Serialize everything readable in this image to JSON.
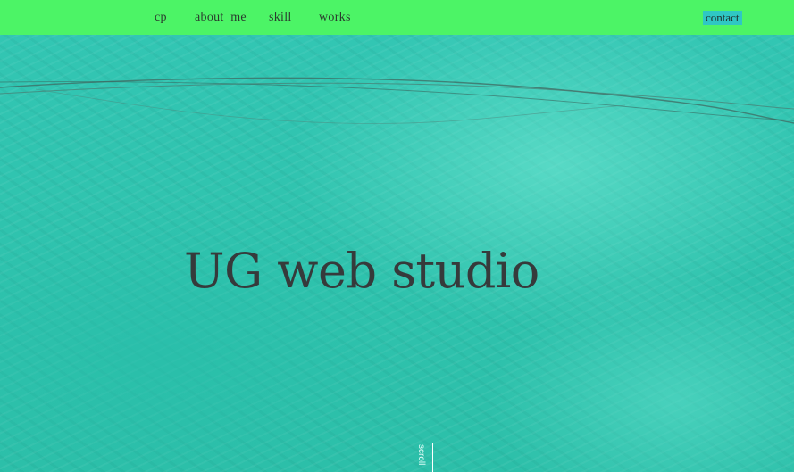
{
  "nav": {
    "items": [
      {
        "label": "cp"
      },
      {
        "label": "about  me"
      },
      {
        "label": "skill"
      },
      {
        "label": "works"
      }
    ],
    "contact_label": "contact"
  },
  "hero": {
    "title": "UG web studio",
    "scroll_label": "scroll"
  },
  "colors": {
    "navbar": "#4cf466",
    "water": "#2fc3ae",
    "contact_bg": "#2fc7c4",
    "title_text": "#363a3b"
  }
}
